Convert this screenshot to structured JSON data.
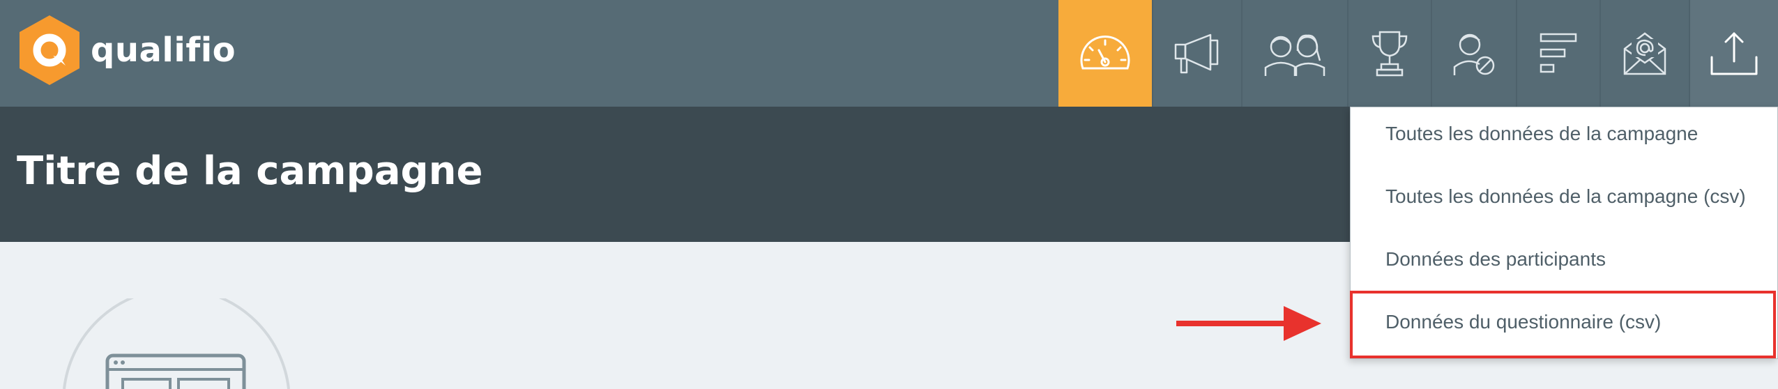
{
  "brand": {
    "name": "qualifio",
    "accent": "#f7ab3b",
    "orange": "#f79a2e"
  },
  "nav": {
    "items": [
      {
        "icon": "dashboard-icon",
        "active": true
      },
      {
        "icon": "megaphone-icon"
      },
      {
        "icon": "participants-icon"
      },
      {
        "icon": "trophy-icon"
      },
      {
        "icon": "user-blocked-icon"
      },
      {
        "icon": "bars-icon"
      },
      {
        "icon": "email-icon"
      },
      {
        "icon": "export-icon",
        "open": true
      }
    ]
  },
  "header": {
    "title": "Titre de la campagne"
  },
  "export_menu": {
    "items": [
      "Toutes les données de la campagne",
      "Toutes les données de la campagne (csv)",
      "Données des participants",
      "Données du questionnaire (csv)"
    ],
    "highlighted_index": 3,
    "highlight_color": "#e8322d"
  },
  "annotation": {
    "arrow_color": "#e8322d"
  }
}
